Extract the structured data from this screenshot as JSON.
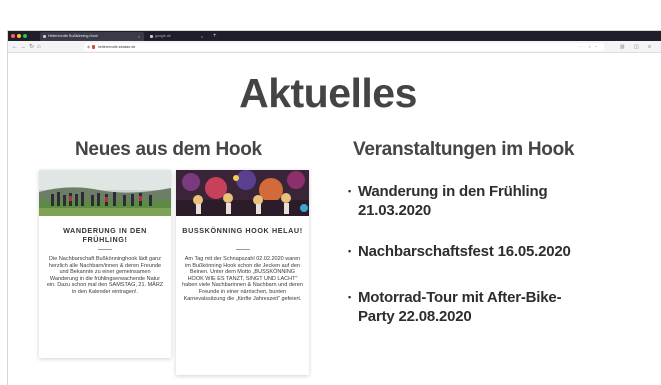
{
  "browser": {
    "tabs": [
      {
        "title": "Heiterervolle Bußkönning-Hook"
      },
      {
        "title": "google.de"
      }
    ],
    "new_tab_label": "+",
    "url": "heiterervolle-strasse.de",
    "nav": {
      "back": "←",
      "forward": "→",
      "reload": "↻",
      "home": "⌂"
    }
  },
  "page": {
    "title": "Aktuelles",
    "news": {
      "heading": "Neues aus dem Hook",
      "cards": [
        {
          "title": "WANDERUNG IN DEN FRÜHLING!",
          "text": "Die Nachbarschaft Bußkönninghook lädt ganz herzlich alle Nachbarn/innen & deren Freunde und Bekannte zu einer gemeinsamen Wanderung in die frühlingserwachende Natur ein. Dazu schon mal den SAMSTAG, 21. MÄRZ in den Kalender eintragen!."
        },
        {
          "title": "BUSSKÖNNING HOOK HELAU!",
          "text": "Am Tag mit der Schnapszahl 02.02.2020 waren im Bußkönning Hook schon die Jecken auf den Beinen. Unter dem Motto „BUSSKÖNNING HOOK WIE ES TANZT, SINGT UND LACHT\" haben viele Nachbarinnen & Nachbarn und deren Freunde in einer närrischen, bunten Karnevalssitzung die „fünfte Jahreszeit\" gefeiert."
        }
      ]
    },
    "events": {
      "heading": "Veranstaltungen im Hook",
      "items": [
        {
          "label": "Wanderung in den Frühling 21.03.2020"
        },
        {
          "label": "Nachbarschaftsfest 16.05.2020"
        },
        {
          "label": "Motorrad-Tour mit After-Bike-Party 22.08.2020"
        }
      ]
    }
  },
  "colors": {
    "tabbar": "#1f1f2b",
    "heading": "#444444",
    "text": "#2e2e2e"
  }
}
